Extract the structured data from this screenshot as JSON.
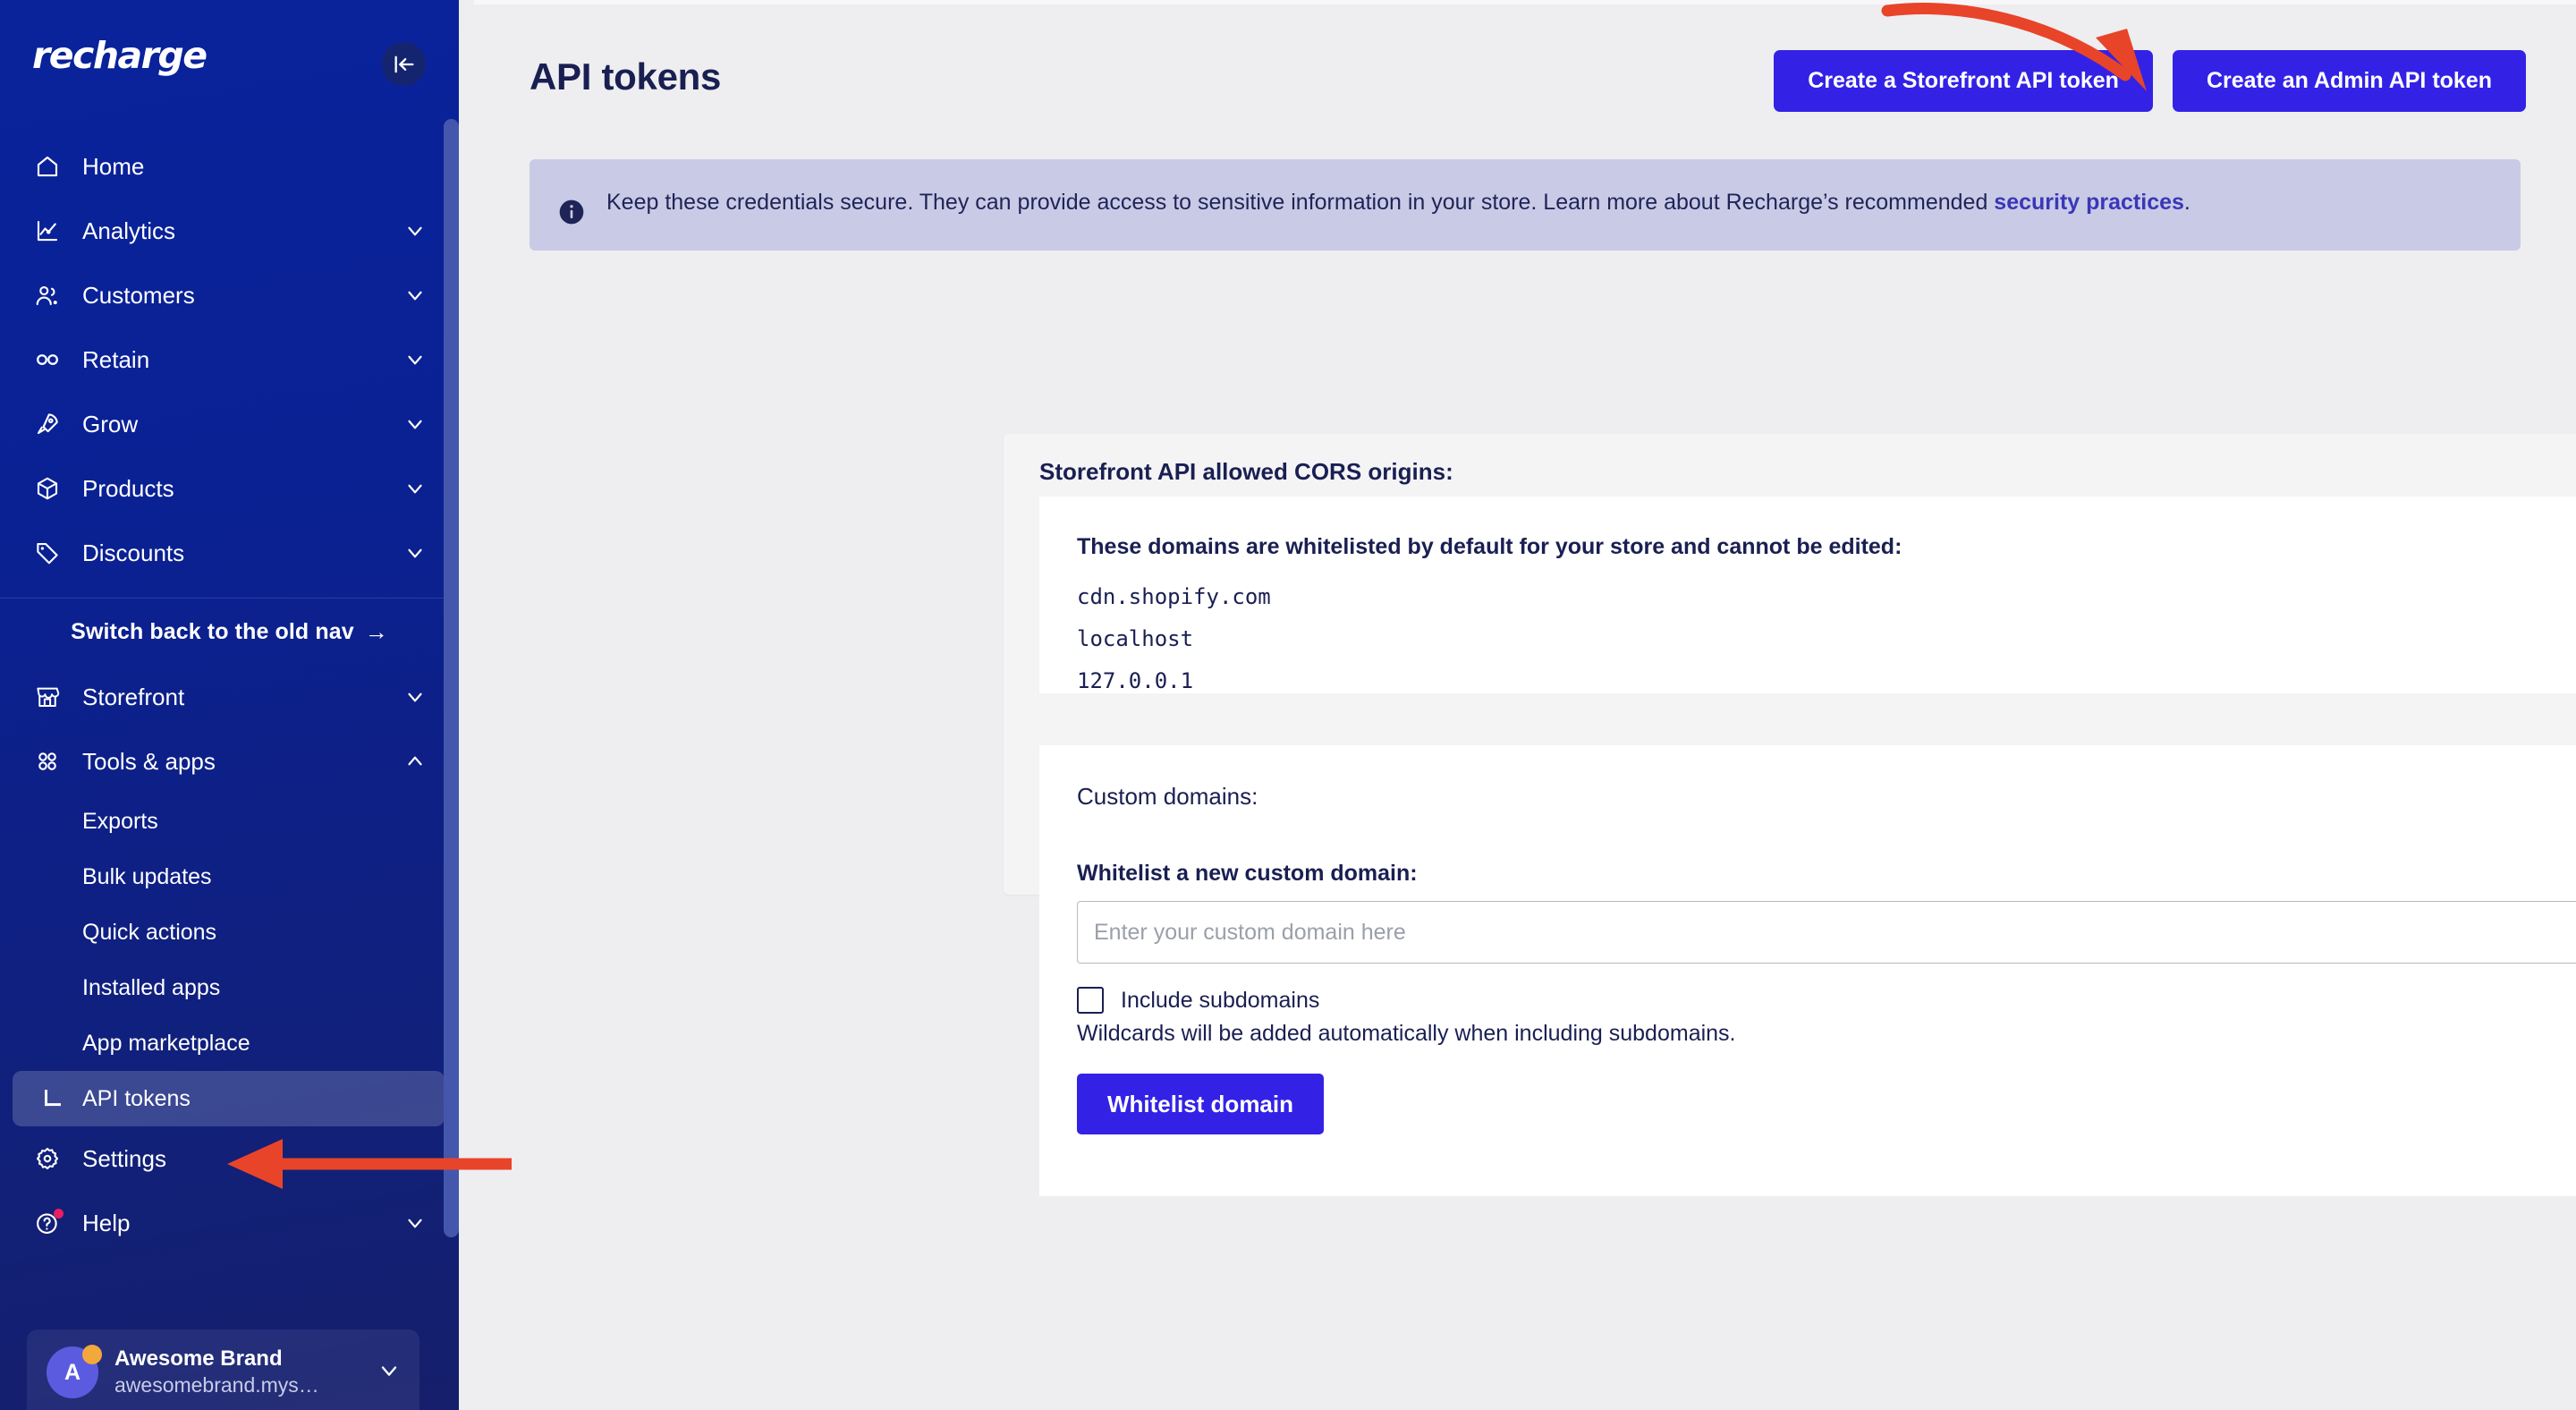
{
  "sidebar": {
    "brand": "recharge",
    "collapse_icon": "collapse-left-icon",
    "nav_items": [
      {
        "label": "Home",
        "icon": "home-icon",
        "has_chevron": false
      },
      {
        "label": "Analytics",
        "icon": "chart-line-icon",
        "has_chevron": true
      },
      {
        "label": "Customers",
        "icon": "people-icon",
        "has_chevron": true
      },
      {
        "label": "Retain",
        "icon": "infinity-icon",
        "has_chevron": true
      },
      {
        "label": "Grow",
        "icon": "rocket-icon",
        "has_chevron": true
      },
      {
        "label": "Products",
        "icon": "box-icon",
        "has_chevron": true
      },
      {
        "label": "Discounts",
        "icon": "tag-icon",
        "has_chevron": true
      }
    ],
    "switch_nav_label": "Switch back to the old nav",
    "switch_nav_arrow": "→",
    "nav_items_2": [
      {
        "label": "Storefront",
        "icon": "store-icon",
        "has_chevron": true,
        "expanded": false
      },
      {
        "label": "Tools & apps",
        "icon": "grid-apps-icon",
        "has_chevron": true,
        "expanded": true
      }
    ],
    "sub_items": [
      {
        "label": "Exports",
        "active": false
      },
      {
        "label": "Bulk updates",
        "active": false
      },
      {
        "label": "Quick actions",
        "active": false
      },
      {
        "label": "Installed apps",
        "active": false
      },
      {
        "label": "App marketplace",
        "active": false
      },
      {
        "label": "API tokens",
        "active": true
      }
    ],
    "nav_items_3": [
      {
        "label": "Settings",
        "icon": "gear-icon",
        "has_chevron": false,
        "badge": false
      },
      {
        "label": "Help",
        "icon": "question-circle-icon",
        "has_chevron": true,
        "badge": true
      }
    ],
    "store": {
      "avatar_initial": "A",
      "name": "Awesome Brand",
      "domain": "awesomebrand.mys…",
      "chevron_icon": "chevron-down-icon"
    }
  },
  "header": {
    "title": "API tokens",
    "buttons": [
      {
        "label": "Create a Storefront API token"
      },
      {
        "label": "Create an Admin API token"
      }
    ]
  },
  "banner": {
    "icon": "info-circle-icon",
    "text_before": "Keep these credentials secure. They can provide access to sensitive information in your store. Learn more about Recharge’s recommended ",
    "link_text": "security practices",
    "text_after": "."
  },
  "cors_card": {
    "title": "Storefront API allowed CORS origins:",
    "lead": "These domains are whitelisted by default for your store and cannot be edited:",
    "domains": [
      "cdn.shopify.com",
      "localhost",
      "127.0.0.1"
    ]
  },
  "custom_domains_card": {
    "title": "Custom domains:",
    "field_label": "Whitelist a new custom domain:",
    "input_placeholder": "Enter your custom domain here",
    "input_value": "",
    "checkbox_label": "Include subdomains",
    "checkbox_checked": false,
    "hint": "Wildcards will be added automatically when including subdomains.",
    "submit_label": "Whitelist domain"
  },
  "annotations": {
    "color": "#E8442A",
    "top_arrow_target": "Create an Admin API token",
    "left_arrow_target": "API tokens"
  },
  "colors": {
    "sidebar_bg": "#0A239B",
    "accent_button": "#3322E5",
    "banner_bg": "#C9CBE6",
    "text_primary": "#1A1F52",
    "annotation": "#E8442A"
  }
}
